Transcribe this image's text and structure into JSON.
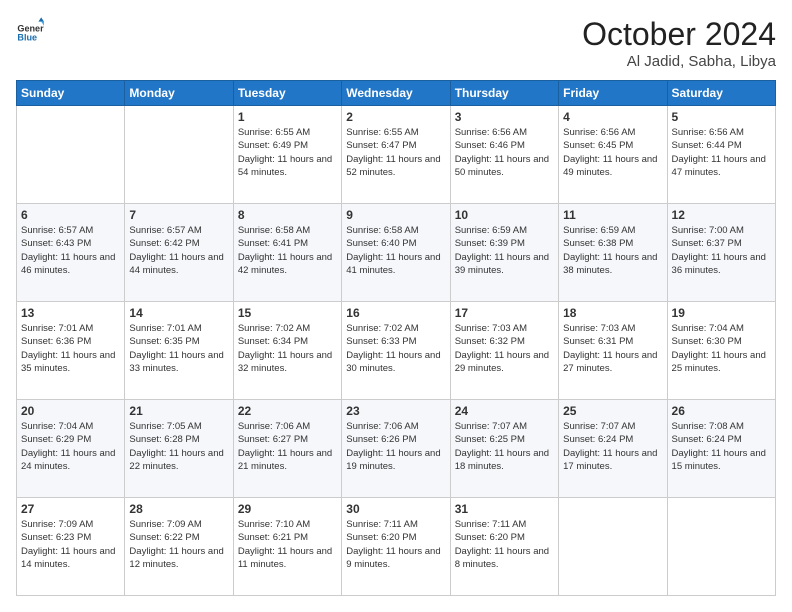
{
  "header": {
    "logo_general": "General",
    "logo_blue": "Blue",
    "month": "October 2024",
    "location": "Al Jadid, Sabha, Libya"
  },
  "weekdays": [
    "Sunday",
    "Monday",
    "Tuesday",
    "Wednesday",
    "Thursday",
    "Friday",
    "Saturday"
  ],
  "weeks": [
    [
      {
        "day": "",
        "info": ""
      },
      {
        "day": "",
        "info": ""
      },
      {
        "day": "1",
        "info": "Sunrise: 6:55 AM\nSunset: 6:49 PM\nDaylight: 11 hours and 54 minutes."
      },
      {
        "day": "2",
        "info": "Sunrise: 6:55 AM\nSunset: 6:47 PM\nDaylight: 11 hours and 52 minutes."
      },
      {
        "day": "3",
        "info": "Sunrise: 6:56 AM\nSunset: 6:46 PM\nDaylight: 11 hours and 50 minutes."
      },
      {
        "day": "4",
        "info": "Sunrise: 6:56 AM\nSunset: 6:45 PM\nDaylight: 11 hours and 49 minutes."
      },
      {
        "day": "5",
        "info": "Sunrise: 6:56 AM\nSunset: 6:44 PM\nDaylight: 11 hours and 47 minutes."
      }
    ],
    [
      {
        "day": "6",
        "info": "Sunrise: 6:57 AM\nSunset: 6:43 PM\nDaylight: 11 hours and 46 minutes."
      },
      {
        "day": "7",
        "info": "Sunrise: 6:57 AM\nSunset: 6:42 PM\nDaylight: 11 hours and 44 minutes."
      },
      {
        "day": "8",
        "info": "Sunrise: 6:58 AM\nSunset: 6:41 PM\nDaylight: 11 hours and 42 minutes."
      },
      {
        "day": "9",
        "info": "Sunrise: 6:58 AM\nSunset: 6:40 PM\nDaylight: 11 hours and 41 minutes."
      },
      {
        "day": "10",
        "info": "Sunrise: 6:59 AM\nSunset: 6:39 PM\nDaylight: 11 hours and 39 minutes."
      },
      {
        "day": "11",
        "info": "Sunrise: 6:59 AM\nSunset: 6:38 PM\nDaylight: 11 hours and 38 minutes."
      },
      {
        "day": "12",
        "info": "Sunrise: 7:00 AM\nSunset: 6:37 PM\nDaylight: 11 hours and 36 minutes."
      }
    ],
    [
      {
        "day": "13",
        "info": "Sunrise: 7:01 AM\nSunset: 6:36 PM\nDaylight: 11 hours and 35 minutes."
      },
      {
        "day": "14",
        "info": "Sunrise: 7:01 AM\nSunset: 6:35 PM\nDaylight: 11 hours and 33 minutes."
      },
      {
        "day": "15",
        "info": "Sunrise: 7:02 AM\nSunset: 6:34 PM\nDaylight: 11 hours and 32 minutes."
      },
      {
        "day": "16",
        "info": "Sunrise: 7:02 AM\nSunset: 6:33 PM\nDaylight: 11 hours and 30 minutes."
      },
      {
        "day": "17",
        "info": "Sunrise: 7:03 AM\nSunset: 6:32 PM\nDaylight: 11 hours and 29 minutes."
      },
      {
        "day": "18",
        "info": "Sunrise: 7:03 AM\nSunset: 6:31 PM\nDaylight: 11 hours and 27 minutes."
      },
      {
        "day": "19",
        "info": "Sunrise: 7:04 AM\nSunset: 6:30 PM\nDaylight: 11 hours and 25 minutes."
      }
    ],
    [
      {
        "day": "20",
        "info": "Sunrise: 7:04 AM\nSunset: 6:29 PM\nDaylight: 11 hours and 24 minutes."
      },
      {
        "day": "21",
        "info": "Sunrise: 7:05 AM\nSunset: 6:28 PM\nDaylight: 11 hours and 22 minutes."
      },
      {
        "day": "22",
        "info": "Sunrise: 7:06 AM\nSunset: 6:27 PM\nDaylight: 11 hours and 21 minutes."
      },
      {
        "day": "23",
        "info": "Sunrise: 7:06 AM\nSunset: 6:26 PM\nDaylight: 11 hours and 19 minutes."
      },
      {
        "day": "24",
        "info": "Sunrise: 7:07 AM\nSunset: 6:25 PM\nDaylight: 11 hours and 18 minutes."
      },
      {
        "day": "25",
        "info": "Sunrise: 7:07 AM\nSunset: 6:24 PM\nDaylight: 11 hours and 17 minutes."
      },
      {
        "day": "26",
        "info": "Sunrise: 7:08 AM\nSunset: 6:24 PM\nDaylight: 11 hours and 15 minutes."
      }
    ],
    [
      {
        "day": "27",
        "info": "Sunrise: 7:09 AM\nSunset: 6:23 PM\nDaylight: 11 hours and 14 minutes."
      },
      {
        "day": "28",
        "info": "Sunrise: 7:09 AM\nSunset: 6:22 PM\nDaylight: 11 hours and 12 minutes."
      },
      {
        "day": "29",
        "info": "Sunrise: 7:10 AM\nSunset: 6:21 PM\nDaylight: 11 hours and 11 minutes."
      },
      {
        "day": "30",
        "info": "Sunrise: 7:11 AM\nSunset: 6:20 PM\nDaylight: 11 hours and 9 minutes."
      },
      {
        "day": "31",
        "info": "Sunrise: 7:11 AM\nSunset: 6:20 PM\nDaylight: 11 hours and 8 minutes."
      },
      {
        "day": "",
        "info": ""
      },
      {
        "day": "",
        "info": ""
      }
    ]
  ]
}
